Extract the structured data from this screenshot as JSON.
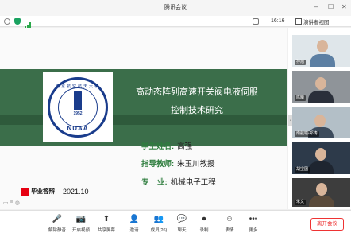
{
  "app": {
    "title": "腾讯会议"
  },
  "window_controls": {
    "minimize": "–",
    "maximize": "☐",
    "close": "✕"
  },
  "status": {
    "time": "16:16",
    "view_label": "演讲者视图",
    "colors": {
      "shield": "#1aa260",
      "signal": "#2aa84a"
    }
  },
  "slide": {
    "title_line1": "高动态阵列高速开关阀电液伺服",
    "title_line2": "控制技术研究",
    "seal": {
      "name": "南京航空航天大学",
      "year": "1952",
      "abbr": "NUAA"
    },
    "info": [
      {
        "label": "学生姓名:",
        "value": "高强"
      },
      {
        "label": "指导教师:",
        "value": "朱玉川教授"
      },
      {
        "label": "专    业:",
        "value": "机械电子工程"
      }
    ],
    "grad_label": "毕业答辩",
    "grad_date": "2021.10",
    "colors": {
      "band": "#3b6e4a",
      "label": "#2e7d3e",
      "seal": "#1a3c8c",
      "accent_red": "#e60012"
    }
  },
  "participants": [
    {
      "name": "孙旭",
      "bg": "#cfd8dc"
    },
    {
      "name": "陈曦",
      "bg": "#9e9e9e"
    },
    {
      "name": "南航喻-郑涛",
      "bg": "#b0bec5"
    },
    {
      "name": "胡宝国",
      "bg": "#2d3a4a"
    },
    {
      "name": "朱文",
      "bg": "#4a4a4a"
    }
  ],
  "toolbar": {
    "items": [
      {
        "label": "解除静音",
        "icon": "mic-muted-icon",
        "glyph": "🎤"
      },
      {
        "label": "开启视频",
        "icon": "camera-off-icon",
        "glyph": "📷"
      },
      {
        "label": "共享屏幕",
        "icon": "share-screen-icon",
        "glyph": "⬆"
      },
      {
        "label": "邀请",
        "icon": "invite-icon",
        "glyph": "👤"
      },
      {
        "label": "成员(26)",
        "icon": "members-icon",
        "glyph": "👥"
      },
      {
        "label": "聊天",
        "icon": "chat-icon",
        "glyph": "💬"
      },
      {
        "label": "录制",
        "icon": "record-icon",
        "glyph": "⏺"
      },
      {
        "label": "表情",
        "icon": "emoji-icon",
        "glyph": "☺"
      },
      {
        "label": "更多",
        "icon": "more-icon",
        "glyph": "•••"
      }
    ],
    "leave_label": "离开会议"
  }
}
